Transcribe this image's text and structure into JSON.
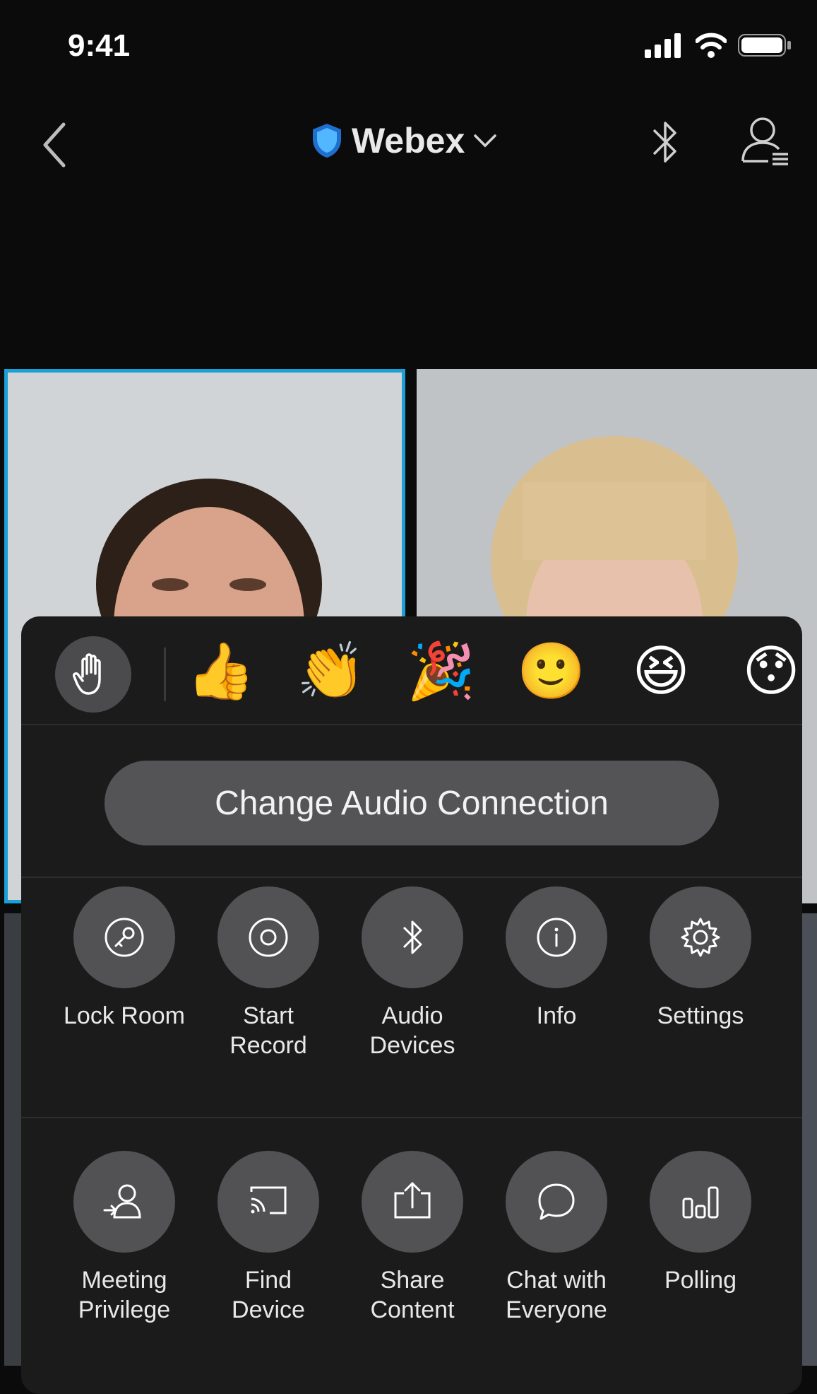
{
  "status": {
    "time": "9:41"
  },
  "nav": {
    "title": "Webex"
  },
  "reactions": [
    "👍",
    "👏",
    "🎉",
    "🙂",
    "😆",
    "😯"
  ],
  "audio": {
    "label": "Change Audio Connection"
  },
  "actions_row1": [
    {
      "label": "Lock Room",
      "icon": "key-icon"
    },
    {
      "label": "Start\nRecord",
      "icon": "record-icon"
    },
    {
      "label": "Audio\nDevices",
      "icon": "bluetooth-icon"
    },
    {
      "label": "Info",
      "icon": "info-icon"
    },
    {
      "label": "Settings",
      "icon": "gear-icon"
    }
  ],
  "actions_row2": [
    {
      "label": "Meeting\nPrivilege",
      "icon": "meeting-privilege-icon"
    },
    {
      "label": "Find\nDevice",
      "icon": "cast-icon"
    },
    {
      "label": "Share\nContent",
      "icon": "share-icon"
    },
    {
      "label": "Chat with\nEveryone",
      "icon": "chat-bubble-icon"
    },
    {
      "label": "Polling",
      "icon": "polling-icon"
    }
  ]
}
